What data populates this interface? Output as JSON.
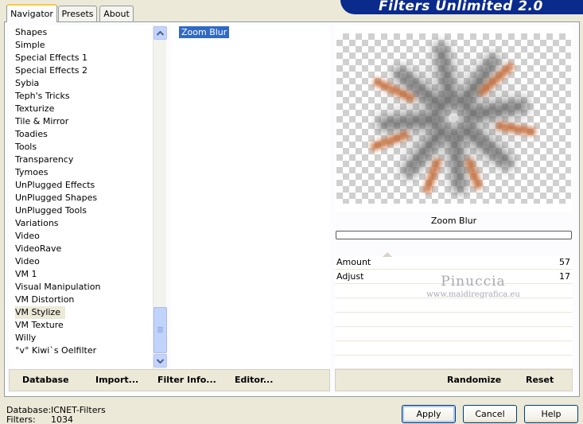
{
  "tabs": [
    {
      "label": "Navigator",
      "active": true
    },
    {
      "label": "Presets",
      "active": false
    },
    {
      "label": "About",
      "active": false
    }
  ],
  "brand": "Filters Unlimited 2.0",
  "categories": [
    "Shapes",
    "Simple",
    "Special Effects 1",
    "Special Effects 2",
    "Sybia",
    "Teph's Tricks",
    "Texturize",
    "Tile & Mirror",
    "Toadies",
    "Tools",
    "Transparency",
    "Tymoes",
    "UnPlugged Effects",
    "UnPlugged Shapes",
    "UnPlugged Tools",
    "Variations",
    "Video",
    "VideoRave",
    "Video",
    "VM 1",
    "Visual Manipulation",
    "VM Distortion",
    "VM Stylize",
    "VM Texture",
    "Willy",
    "°v° Kiwi`s Oelfilter"
  ],
  "selected_category": "VM Stylize",
  "filters": [
    "Zoom Blur"
  ],
  "selected_filter": "Zoom Blur",
  "preview": {
    "filter_title": "Zoom Blur",
    "progress_percent": 0
  },
  "params": [
    {
      "name": "Amount",
      "value": "57",
      "level": 57
    },
    {
      "name": "Adjust",
      "value": "17",
      "level": 17
    }
  ],
  "watermark": {
    "line1": "Pinuccia",
    "line2": "www.maidiregrafica.eu"
  },
  "left_buttons": [
    "Database",
    "Import...",
    "Filter Info...",
    "Editor..."
  ],
  "right_buttons": [
    "Randomize",
    "Reset"
  ],
  "status": {
    "database_label": "Database:",
    "database_value": "ICNET-Filters",
    "filters_label": "Filters:",
    "filters_value": "1034"
  },
  "dialog_buttons": {
    "apply": "Apply",
    "cancel": "Cancel",
    "help": "Help"
  },
  "colors": {
    "accent": "#316ac5",
    "brand": "#0a2a8c",
    "tab_highlight": "#ffc83c"
  }
}
